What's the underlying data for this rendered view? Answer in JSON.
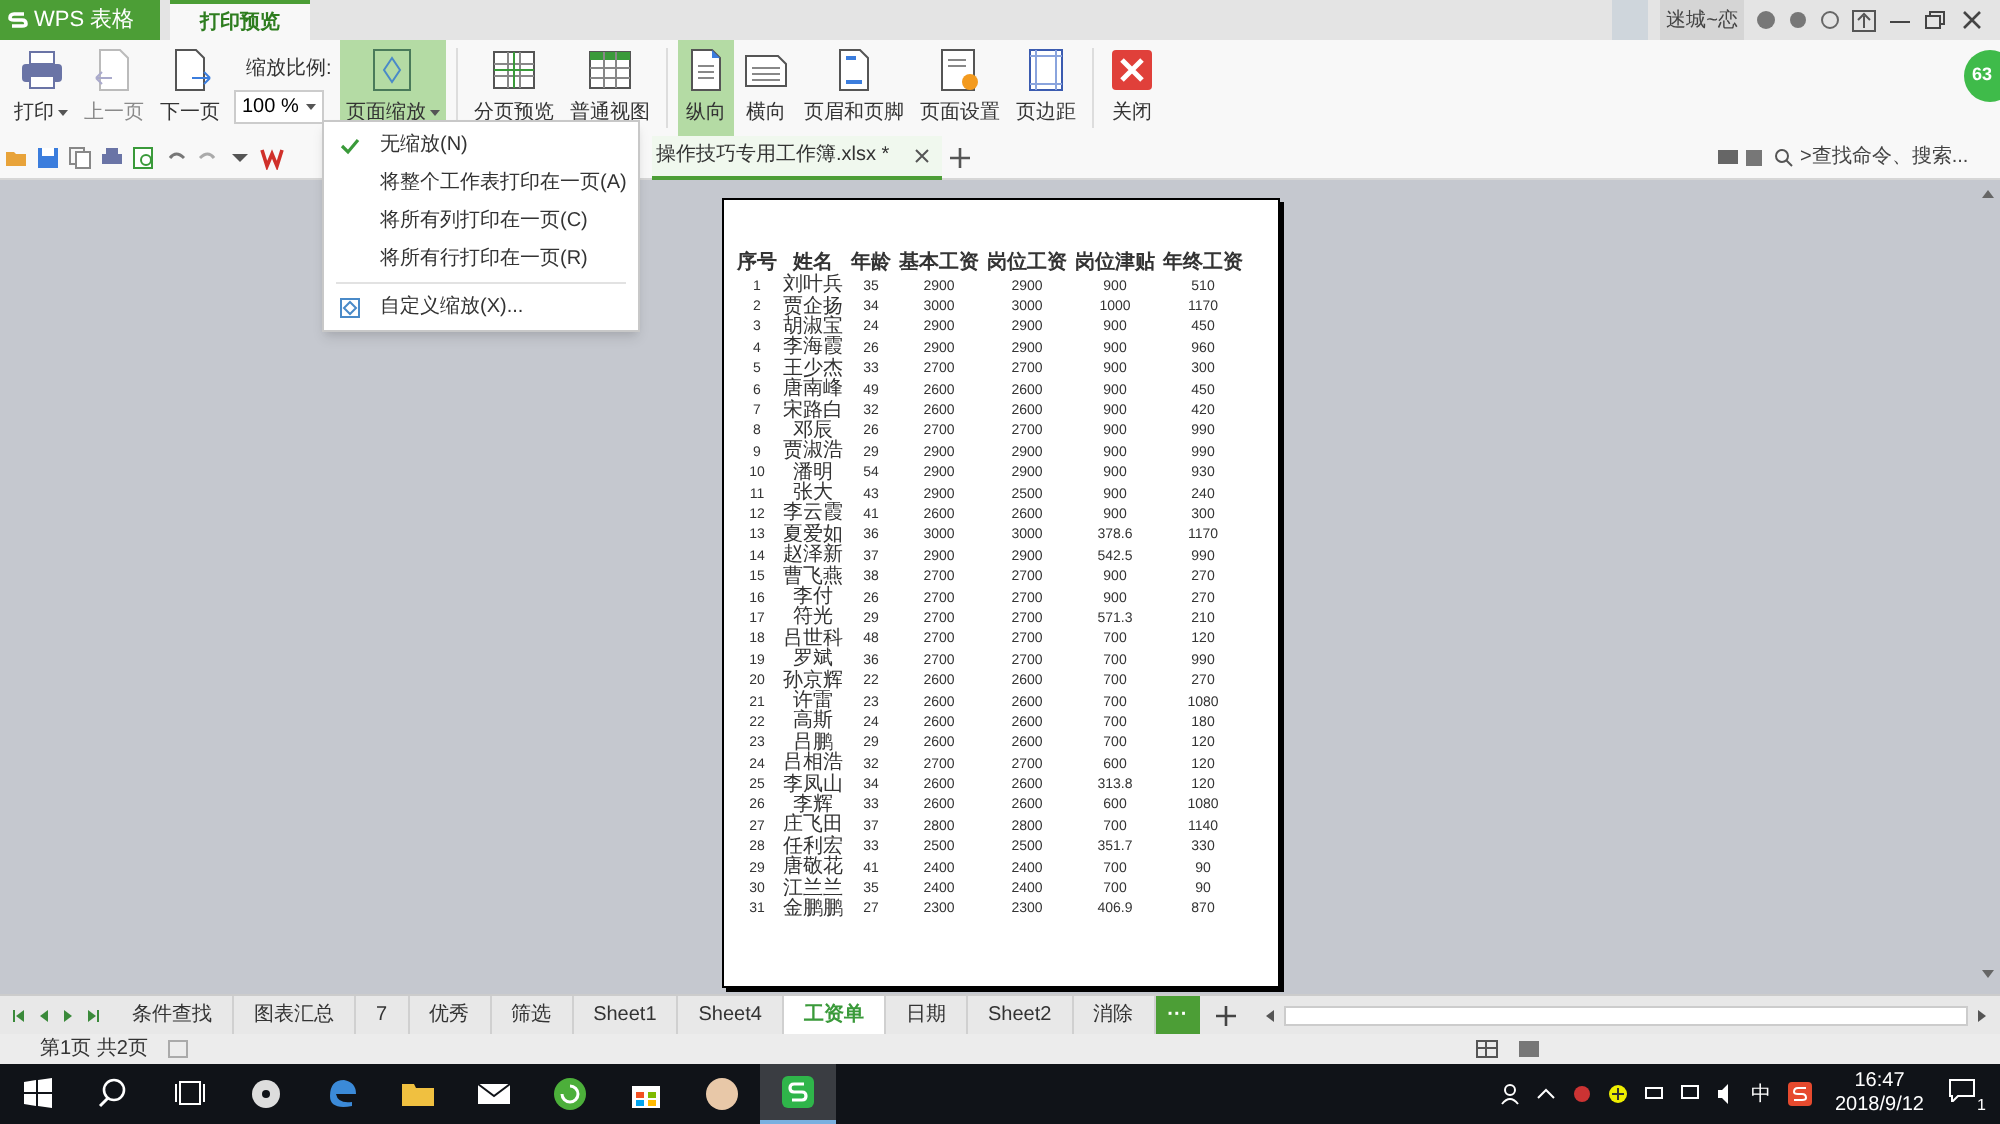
{
  "app_tab": {
    "label": "WPS 表格"
  },
  "ribbon_tabs": [
    {
      "label": "打印预览",
      "selected": true
    }
  ],
  "user": {
    "name": "迷城~恋"
  },
  "ribbon": [
    {
      "kind": "printer",
      "label": "打印",
      "caret": true,
      "selected": false,
      "disabled": false
    },
    {
      "kind": "prev",
      "label": "上一页",
      "caret": false,
      "selected": false,
      "disabled": true
    },
    {
      "kind": "next",
      "label": "下一页",
      "caret": false,
      "selected": false,
      "disabled": false
    },
    {
      "kind": "zoomfield",
      "label": "缩放比例:",
      "value": "100 %"
    },
    {
      "kind": "scale",
      "label": "页面缩放",
      "caret": true,
      "selected": true,
      "disabled": false
    },
    {
      "kind": "sep"
    },
    {
      "kind": "pagebreak",
      "label": "分页预览",
      "caret": false,
      "selected": false,
      "disabled": false
    },
    {
      "kind": "normal",
      "label": "普通视图",
      "caret": false,
      "selected": false,
      "disabled": false
    },
    {
      "kind": "sep"
    },
    {
      "kind": "portrait",
      "label": "纵向",
      "caret": false,
      "selected": true,
      "disabled": false
    },
    {
      "kind": "landscape",
      "label": "横向",
      "caret": false,
      "selected": false,
      "disabled": false
    },
    {
      "kind": "header",
      "label": "页眉和页脚",
      "caret": false,
      "selected": false,
      "disabled": false
    },
    {
      "kind": "setup",
      "label": "页面设置",
      "caret": false,
      "selected": false,
      "disabled": false
    },
    {
      "kind": "margins",
      "label": "页边距",
      "caret": false,
      "selected": false,
      "disabled": false
    },
    {
      "kind": "sep"
    },
    {
      "kind": "close",
      "label": "关闭",
      "caret": false,
      "selected": false,
      "disabled": false
    }
  ],
  "badge": "63",
  "doc_tab": {
    "label": "操作技巧专用工作簿.xlsx *"
  },
  "search": {
    "placeholder": ">查找命令、搜索..."
  },
  "scale_menu": [
    {
      "kind": "option",
      "label": "无缩放(N)",
      "checked": true
    },
    {
      "kind": "option",
      "label": "将整个工作表打印在一页(A)",
      "checked": false
    },
    {
      "kind": "option",
      "label": "将所有列打印在一页(C)",
      "checked": false
    },
    {
      "kind": "option",
      "label": "将所有行打印在一页(R)",
      "checked": false
    },
    {
      "kind": "custom",
      "label": "自定义缩放(X)..."
    }
  ],
  "table": {
    "columns": [
      "序号",
      "姓名",
      "年龄",
      "基本工资",
      "岗位工资",
      "岗位津贴",
      "年终工资"
    ],
    "rows": [
      [
        "1",
        "刘叶兵",
        "35",
        "2900",
        "2900",
        "900",
        "510"
      ],
      [
        "2",
        "贾企扬",
        "34",
        "3000",
        "3000",
        "1000",
        "1170"
      ],
      [
        "3",
        "胡淑宝",
        "24",
        "2900",
        "2900",
        "900",
        "450"
      ],
      [
        "4",
        "李海霞",
        "26",
        "2900",
        "2900",
        "900",
        "960"
      ],
      [
        "5",
        "王少杰",
        "33",
        "2700",
        "2700",
        "900",
        "300"
      ],
      [
        "6",
        "唐南峰",
        "49",
        "2600",
        "2600",
        "900",
        "450"
      ],
      [
        "7",
        "宋路白",
        "32",
        "2600",
        "2600",
        "900",
        "420"
      ],
      [
        "8",
        "邓辰",
        "26",
        "2700",
        "2700",
        "900",
        "990"
      ],
      [
        "9",
        "贾淑浩",
        "29",
        "2900",
        "2900",
        "900",
        "990"
      ],
      [
        "10",
        "潘明",
        "54",
        "2900",
        "2900",
        "900",
        "930"
      ],
      [
        "11",
        "张大",
        "43",
        "2900",
        "2500",
        "900",
        "240"
      ],
      [
        "12",
        "李云霞",
        "41",
        "2600",
        "2600",
        "900",
        "300"
      ],
      [
        "13",
        "夏爱如",
        "36",
        "3000",
        "3000",
        "378.6",
        "1170"
      ],
      [
        "14",
        "赵泽新",
        "37",
        "2900",
        "2900",
        "542.5",
        "990"
      ],
      [
        "15",
        "曹飞燕",
        "38",
        "2700",
        "2700",
        "900",
        "270"
      ],
      [
        "16",
        "李付",
        "26",
        "2700",
        "2700",
        "900",
        "270"
      ],
      [
        "17",
        "符光",
        "29",
        "2700",
        "2700",
        "571.3",
        "210"
      ],
      [
        "18",
        "吕世科",
        "48",
        "2700",
        "2700",
        "700",
        "120"
      ],
      [
        "19",
        "罗斌",
        "36",
        "2700",
        "2700",
        "700",
        "990"
      ],
      [
        "20",
        "孙京辉",
        "22",
        "2600",
        "2600",
        "700",
        "270"
      ],
      [
        "21",
        "许雷",
        "23",
        "2600",
        "2600",
        "700",
        "1080"
      ],
      [
        "22",
        "高斯",
        "24",
        "2600",
        "2600",
        "700",
        "180"
      ],
      [
        "23",
        "吕鹏",
        "29",
        "2600",
        "2600",
        "700",
        "120"
      ],
      [
        "24",
        "吕相浩",
        "32",
        "2700",
        "2700",
        "600",
        "120"
      ],
      [
        "25",
        "李凤山",
        "34",
        "2600",
        "2600",
        "313.8",
        "120"
      ],
      [
        "26",
        "李辉",
        "33",
        "2600",
        "2600",
        "600",
        "1080"
      ],
      [
        "27",
        "庄飞田",
        "37",
        "2800",
        "2800",
        "700",
        "1140"
      ],
      [
        "28",
        "任利宏",
        "33",
        "2500",
        "2500",
        "351.7",
        "330"
      ],
      [
        "29",
        "唐敬花",
        "41",
        "2400",
        "2400",
        "700",
        "90"
      ],
      [
        "30",
        "江兰兰",
        "35",
        "2400",
        "2400",
        "700",
        "90"
      ],
      [
        "31",
        "金鹏鹏",
        "27",
        "2300",
        "2300",
        "406.9",
        "870"
      ]
    ]
  },
  "sheet_tabs": [
    {
      "label": "条件查找",
      "selected": false
    },
    {
      "label": "图表汇总",
      "selected": false
    },
    {
      "label": "7",
      "selected": false
    },
    {
      "label": "优秀",
      "selected": false
    },
    {
      "label": "筛选",
      "selected": false
    },
    {
      "label": "Sheet1",
      "selected": false
    },
    {
      "label": "Sheet4",
      "selected": false
    },
    {
      "label": "工资单",
      "selected": true
    },
    {
      "label": "日期",
      "selected": false
    },
    {
      "label": "Sheet2",
      "selected": false
    },
    {
      "label": "消除",
      "selected": false
    }
  ],
  "more_sheets": "···",
  "status_bar": {
    "page": "第1页 共2页"
  },
  "taskbar": {
    "ime": "中",
    "time": "16:47",
    "date": "2018/9/12",
    "notifications": "1"
  }
}
